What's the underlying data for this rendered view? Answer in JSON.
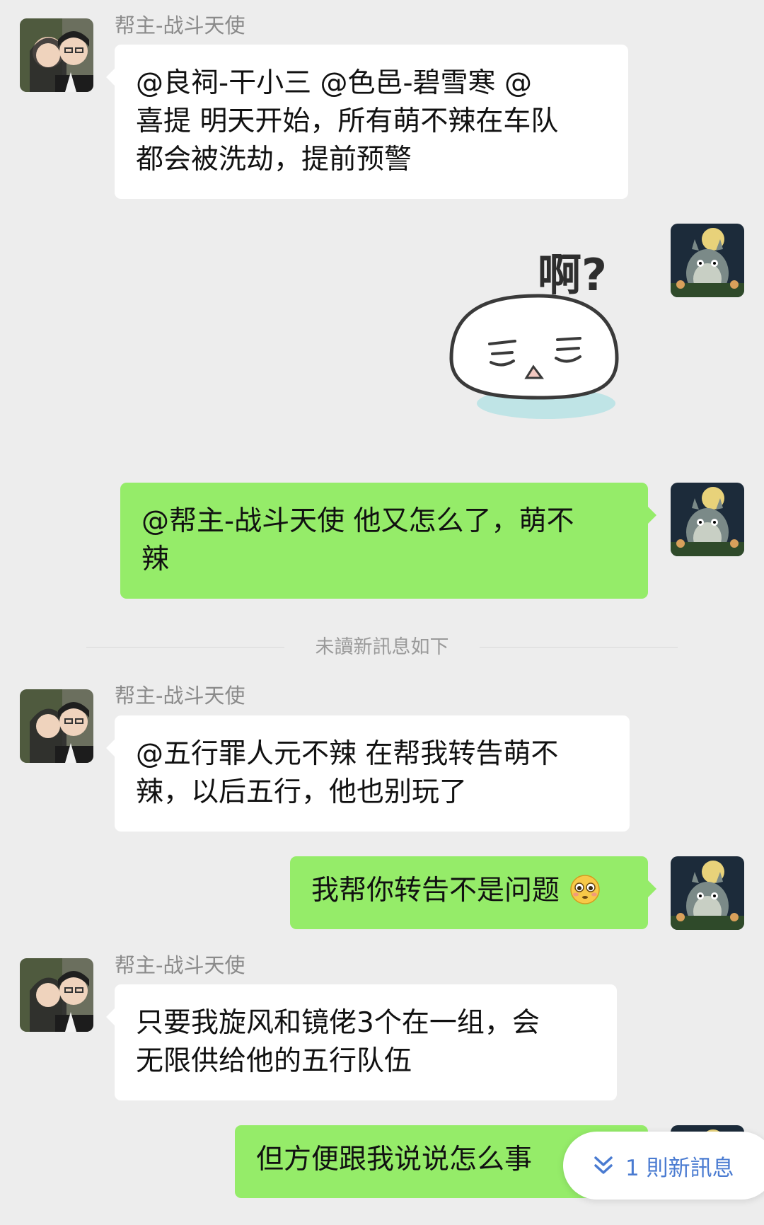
{
  "colors": {
    "background": "#ededed",
    "incoming_bubble": "#ffffff",
    "outgoing_bubble": "#95ec69",
    "sender_name": "#8a8a8a",
    "divider_text": "#9a9a9a",
    "new_message_link": "#4a7bd1"
  },
  "messages": [
    {
      "direction": "incoming",
      "sender": "帮主-战斗天使",
      "lines": [
        "@良祠-干小三 @色邑-碧雪寒 @",
        "喜提 明天开始，所有萌不辣在车队",
        "都会被洗劫，提前预警"
      ]
    },
    {
      "direction": "outgoing",
      "type": "sticker",
      "sticker_text": "啊?",
      "sticker_icon": "confused-bun-sticker"
    },
    {
      "direction": "outgoing",
      "lines": [
        "@帮主-战斗天使 他又怎么了，萌不",
        "辣"
      ]
    },
    {
      "direction": "incoming",
      "sender": "帮主-战斗天使",
      "lines": [
        "@五行罪人元不辣 在帮我转告萌不",
        "辣，以后五行，他也别玩了"
      ]
    },
    {
      "direction": "outgoing",
      "lines": [
        "我帮你转告不是问题"
      ],
      "emoji": "flushed-face-emoji"
    },
    {
      "direction": "incoming",
      "sender": "帮主-战斗天使",
      "lines": [
        "只要我旋风和镜佬3个在一组，会",
        "无限供给他的五行队伍"
      ]
    },
    {
      "direction": "outgoing",
      "lines": [
        "但方便跟我说说怎么事"
      ]
    }
  ],
  "unread_divider": "未讀新訊息如下",
  "new_message_button": {
    "icon": "double-chevron-down-icon",
    "label": "1 則新訊息"
  }
}
